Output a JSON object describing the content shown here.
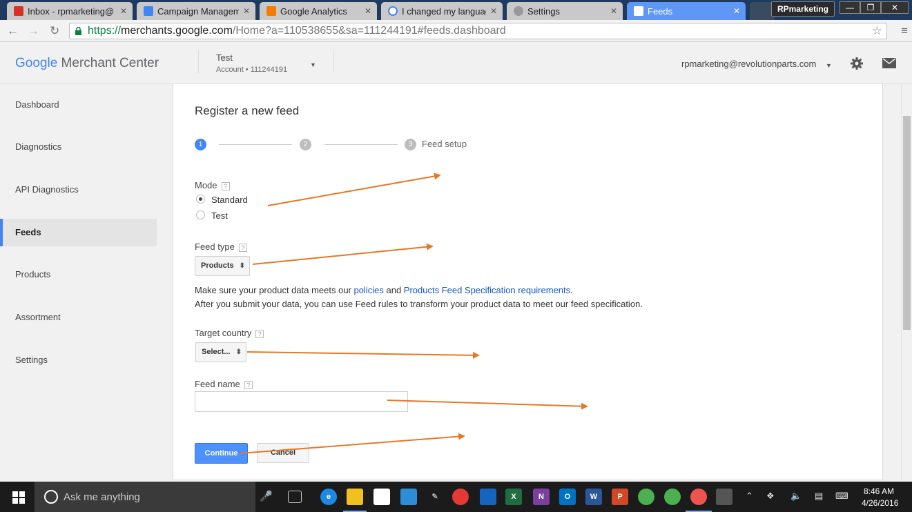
{
  "browser": {
    "tabs": [
      {
        "label": "Inbox - rpmarketing@",
        "color": "#d93025"
      },
      {
        "label": "Campaign Manageme",
        "color": "#4285f4"
      },
      {
        "label": "Google Analytics",
        "color": "#f57c00"
      },
      {
        "label": "I changed my languag",
        "color": "#4285f4"
      },
      {
        "label": "Settings",
        "color": "#888888"
      },
      {
        "label": "Feeds",
        "color": "#4285f4"
      }
    ],
    "profile": "RPmarketing",
    "url_scheme": "https://",
    "url_host": "merchants.google.com",
    "url_path": "/Home?a=110538655&sa=111244191#feeds.dashboard"
  },
  "header": {
    "logo_google": "Google",
    "logo_product": " Merchant Center",
    "account_name": "Test",
    "account_sub": "Account  •  111244191",
    "user_email": "rpmarketing@revolutionparts.com"
  },
  "sidebar": {
    "items": [
      {
        "label": "Dashboard"
      },
      {
        "label": "Diagnostics"
      },
      {
        "label": "API Diagnostics"
      },
      {
        "label": "Feeds",
        "active": true
      },
      {
        "label": "Products"
      },
      {
        "label": "Assortment"
      },
      {
        "label": "Settings"
      }
    ]
  },
  "form": {
    "title": "Register a new feed",
    "steps": [
      "1",
      "2",
      "3"
    ],
    "step3_label": "Feed setup",
    "mode_label": "Mode",
    "mode_options": [
      "Standard",
      "Test"
    ],
    "mode_selected": "Standard",
    "feed_type_label": "Feed type",
    "feed_type_value": "Products",
    "info_line1_prefix": "Make sure your product data meets our ",
    "info_link1": "policies",
    "info_and": " and ",
    "info_link2": "Products Feed Specification requirements",
    "info_line1_suffix": ".",
    "info_line2": "After you submit your data, you can use Feed rules to transform your product data to meet our feed specification.",
    "target_country_label": "Target country",
    "target_country_value": "Select...",
    "feed_name_label": "Feed name",
    "feed_name_value": "",
    "help_glyph": "?",
    "continue_label": "Continue",
    "cancel_label": "Cancel"
  },
  "colors": {
    "accent_blue": "#4d90fe",
    "annotation_orange": "#e87722",
    "link_blue": "#1155cc"
  },
  "taskbar": {
    "search_placeholder": "Ask me anything",
    "time": "8:46 AM",
    "date": "4/26/2016"
  }
}
